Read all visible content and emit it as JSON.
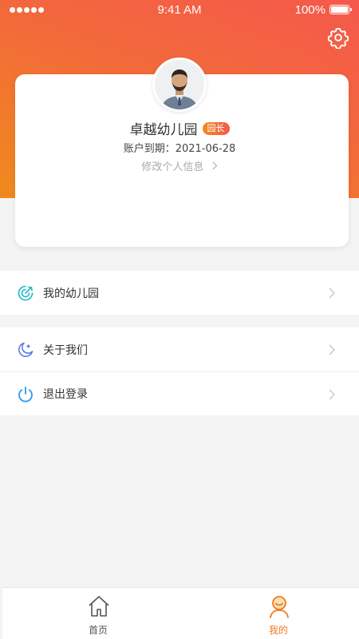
{
  "status_bar": {
    "time": "9:41 AM",
    "battery": "100%"
  },
  "profile": {
    "name": "卓越幼儿园",
    "role": "园长",
    "expiry": "账户到期：2021-06-28",
    "edit_label": "修改个人信息"
  },
  "menu_groups": [
    {
      "items": [
        {
          "label": "我的幼儿园",
          "icon": "target-icon"
        }
      ]
    },
    {
      "items": [
        {
          "label": "关于我们",
          "icon": "moon-icon"
        },
        {
          "label": "退出登录",
          "icon": "power-icon"
        }
      ]
    }
  ],
  "tabbar": {
    "home_label": "首页",
    "mine_label": "我的"
  },
  "colors": {
    "accent": "#f07a23",
    "gradient_start": "#f08a1c",
    "gradient_end": "#f5584c",
    "icon_teal": "#1fb6c8",
    "icon_blue": "#5b7be6",
    "icon_sky": "#2a9af0"
  }
}
